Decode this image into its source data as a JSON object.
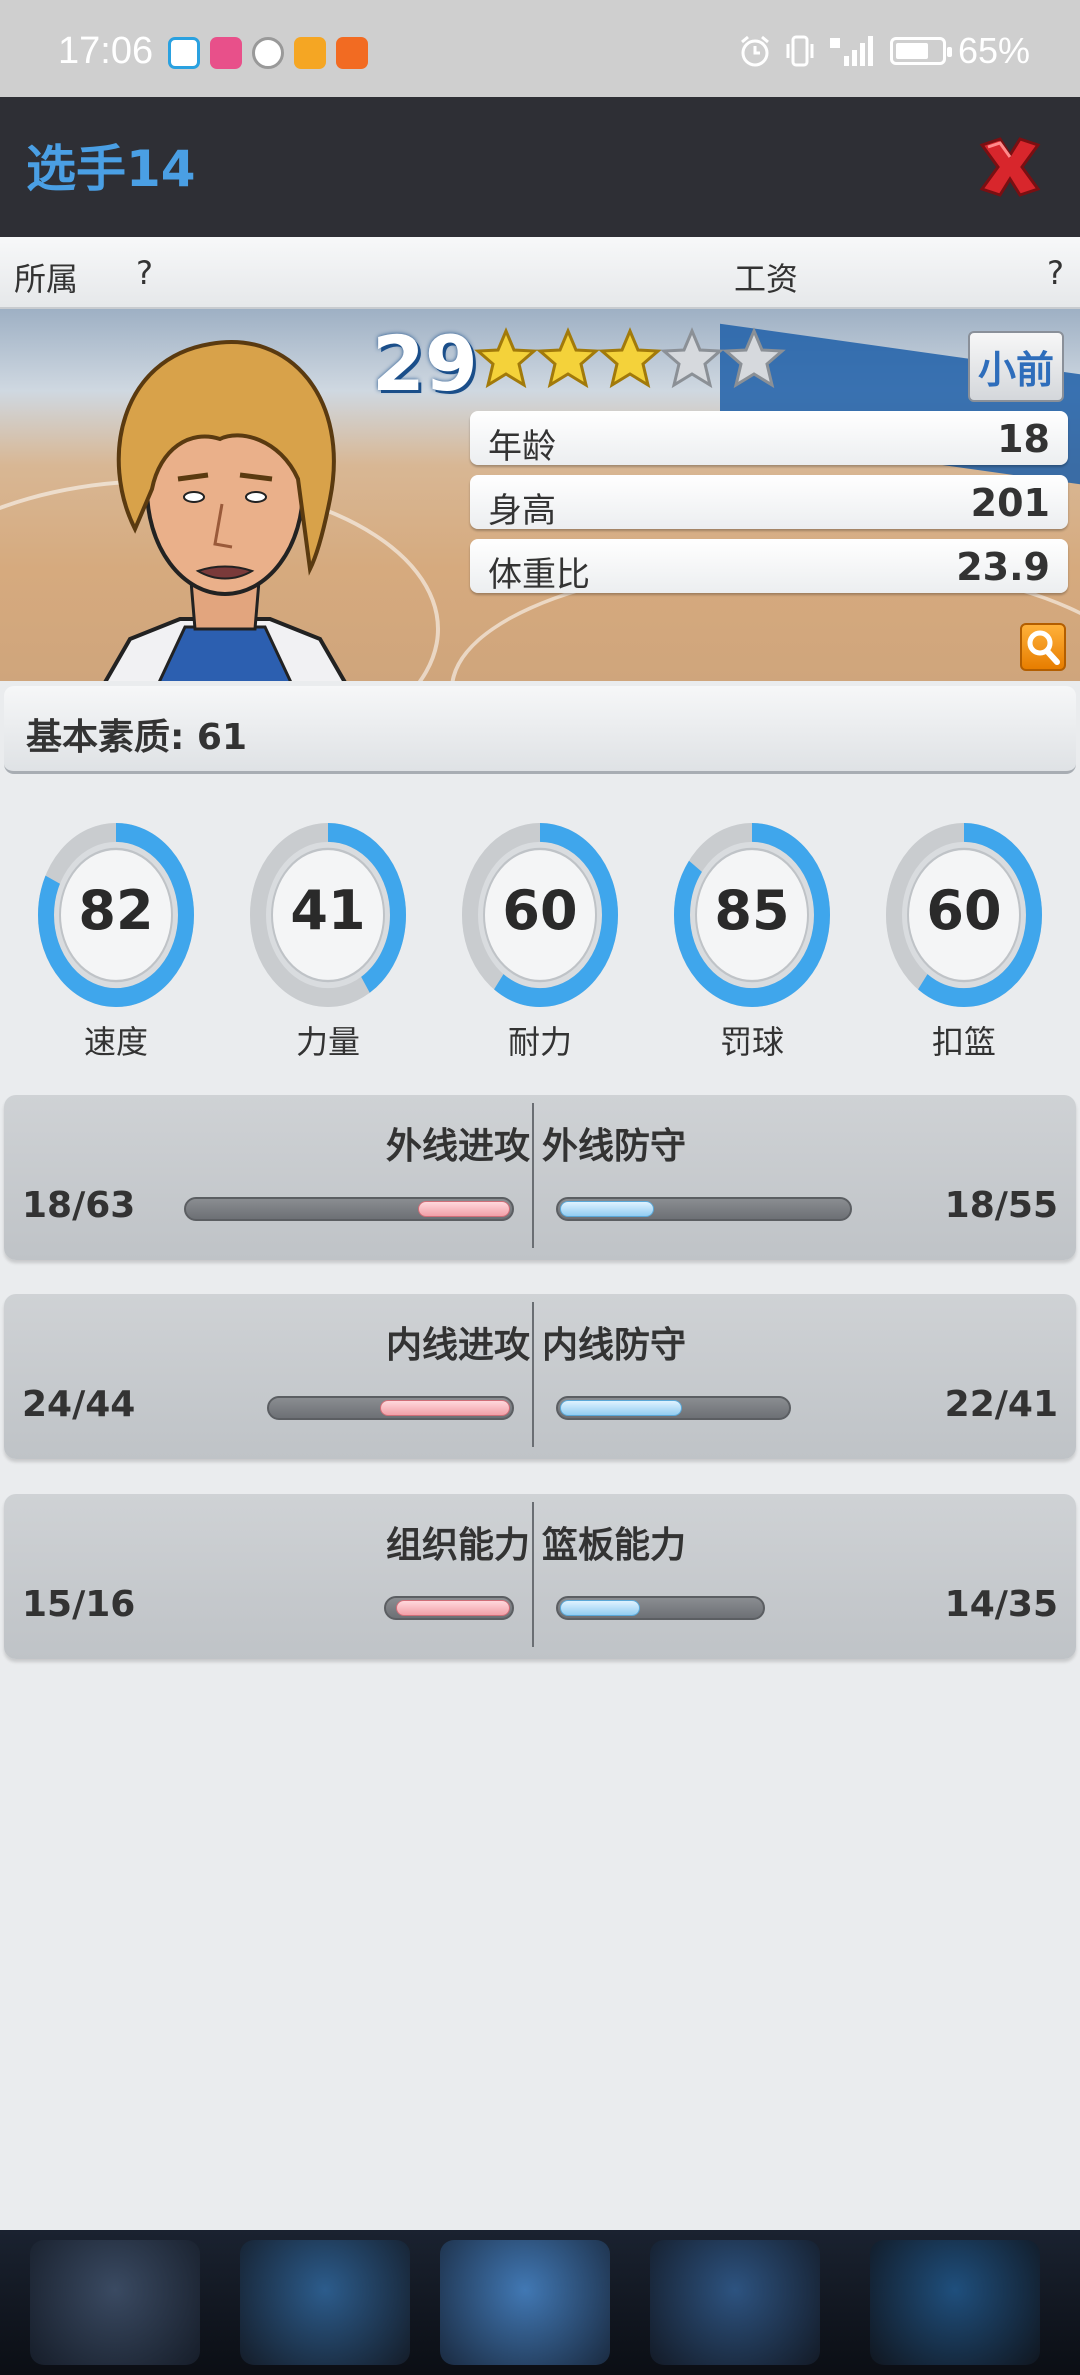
{
  "status_bar": {
    "time": "17:06",
    "battery": "65%"
  },
  "header": {
    "title": "选手14"
  },
  "team_row": {
    "team_label": "所属",
    "team_value": "?",
    "salary_label": "工资",
    "salary_value": "?"
  },
  "player": {
    "rating": "29",
    "stars_filled": 3,
    "stars_total": 5,
    "position": "小前",
    "info": [
      {
        "label": "年龄",
        "value": "18"
      },
      {
        "label": "身高",
        "value": "201"
      },
      {
        "label": "体重比",
        "value": "23.9"
      }
    ]
  },
  "base_quality": "基本素质: 61",
  "attributes": [
    {
      "label": "速度",
      "value": "82",
      "pct": 82
    },
    {
      "label": "力量",
      "value": "41",
      "pct": 41
    },
    {
      "label": "耐力",
      "value": "60",
      "pct": 60
    },
    {
      "label": "罚球",
      "value": "85",
      "pct": 85
    },
    {
      "label": "扣篮",
      "value": "60",
      "pct": 60
    }
  ],
  "compare": [
    {
      "left_title": "外线进攻",
      "left_value": "18/63",
      "right_title": "外线防守",
      "right_value": "18/55",
      "left_fill": 0.2857,
      "right_fill": 0.3273
    },
    {
      "left_title": "内线进攻",
      "left_value": "24/44",
      "right_title": "内线防守",
      "right_value": "22/41",
      "left_fill": 0.5455,
      "right_fill": 0.5366
    },
    {
      "left_title": "组织能力",
      "left_value": "15/16",
      "right_title": "篮板能力",
      "right_value": "14/35",
      "left_fill": 0.9375,
      "right_fill": 0.4
    }
  ],
  "colors": {
    "title_blue": "#4a9fe4",
    "gauge_blue": "#3fa6ec",
    "close_red": "#d8262c",
    "attack_red": "#f2a0a8",
    "defense_blue": "#93cdf2"
  },
  "icons": [
    "close-icon",
    "star-icon",
    "search-icon",
    "alarm-icon",
    "vibrate-icon",
    "signal-icon",
    "battery-icon"
  ]
}
